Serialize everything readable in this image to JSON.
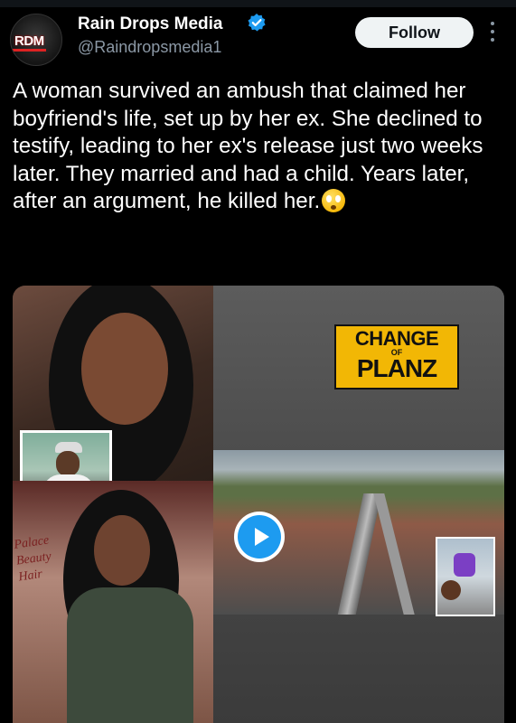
{
  "author": {
    "display_name": "Rain Drops Media",
    "handle": "@Raindropsmedia1",
    "avatar_text": "RDM",
    "verified": true
  },
  "actions": {
    "follow_label": "Follow"
  },
  "tweet": {
    "text": "A woman survived an ambush that claimed her boyfriend's life, set up by her ex. She declined to testify, leading to her ex's release just two weeks later. They married and had a child. Years later, after an argument, he killed her.",
    "emoji": "flushed-face-emoji"
  },
  "media": {
    "logo_line1": "CHANGE",
    "logo_line2": "OF",
    "logo_line3": "PLANZ",
    "signage_text": "Palace\nBeauty\nHair",
    "play_icon": "play-icon"
  },
  "colors": {
    "background": "#000000",
    "verified_badge": "#1d9bf0",
    "follow_button_bg": "#eff3f4",
    "handle_gray": "#8b98a5",
    "logo_yellow": "#f2b705"
  }
}
